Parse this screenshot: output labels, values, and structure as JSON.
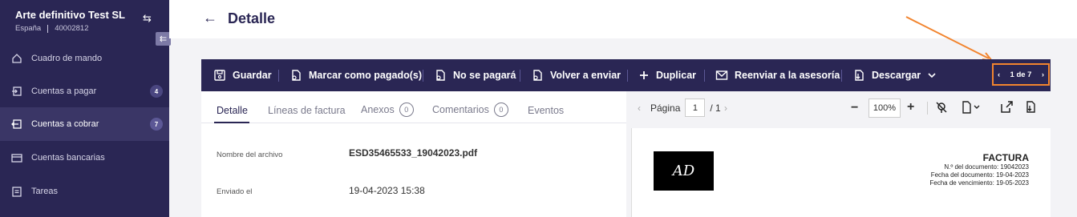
{
  "sidebar": {
    "company_name": "Arte definitivo Test SL",
    "country": "España",
    "company_id": "40002812",
    "items": [
      {
        "label": "Cuadro de mando",
        "badge": ""
      },
      {
        "label": "Cuentas a pagar",
        "badge": "4"
      },
      {
        "label": "Cuentas a cobrar",
        "badge": "7"
      },
      {
        "label": "Cuentas bancarias",
        "badge": ""
      },
      {
        "label": "Tareas",
        "badge": ""
      }
    ]
  },
  "header": {
    "title": "Detalle"
  },
  "toolbar": {
    "save": "Guardar",
    "mark_paid": "Marcar como pagado(s)",
    "no_pay": "No se pagará",
    "resend": "Volver a enviar",
    "duplicate": "Duplicar",
    "forward": "Reenviar a la asesoría",
    "download": "Descargar",
    "pager": "1 de 7"
  },
  "tabs": {
    "detail": "Detalle",
    "lines": "Líneas de factura",
    "attachments": "Anexos",
    "attachments_count": "0",
    "comments": "Comentarios",
    "comments_count": "0",
    "events": "Eventos"
  },
  "fields": {
    "filename_label": "Nombre del archivo",
    "filename_value": "ESD35465533_19042023.pdf",
    "sent_label": "Enviado el",
    "sent_value": "19-04-2023 15:38"
  },
  "viewer": {
    "page_label": "Página",
    "page_current": "1",
    "page_total": "/ 1",
    "zoom": "100%"
  },
  "invoice": {
    "logo_text": "AD",
    "title": "FACTURA",
    "doc_number": "N.º del documento: 19042023",
    "doc_date": "Fecha del documento: 19-04-2023",
    "due_date": "Fecha de vencimiento: 19-05-2023"
  },
  "colors": {
    "sidebar_bg": "#2a2654",
    "accent_orange": "#f2842e"
  }
}
